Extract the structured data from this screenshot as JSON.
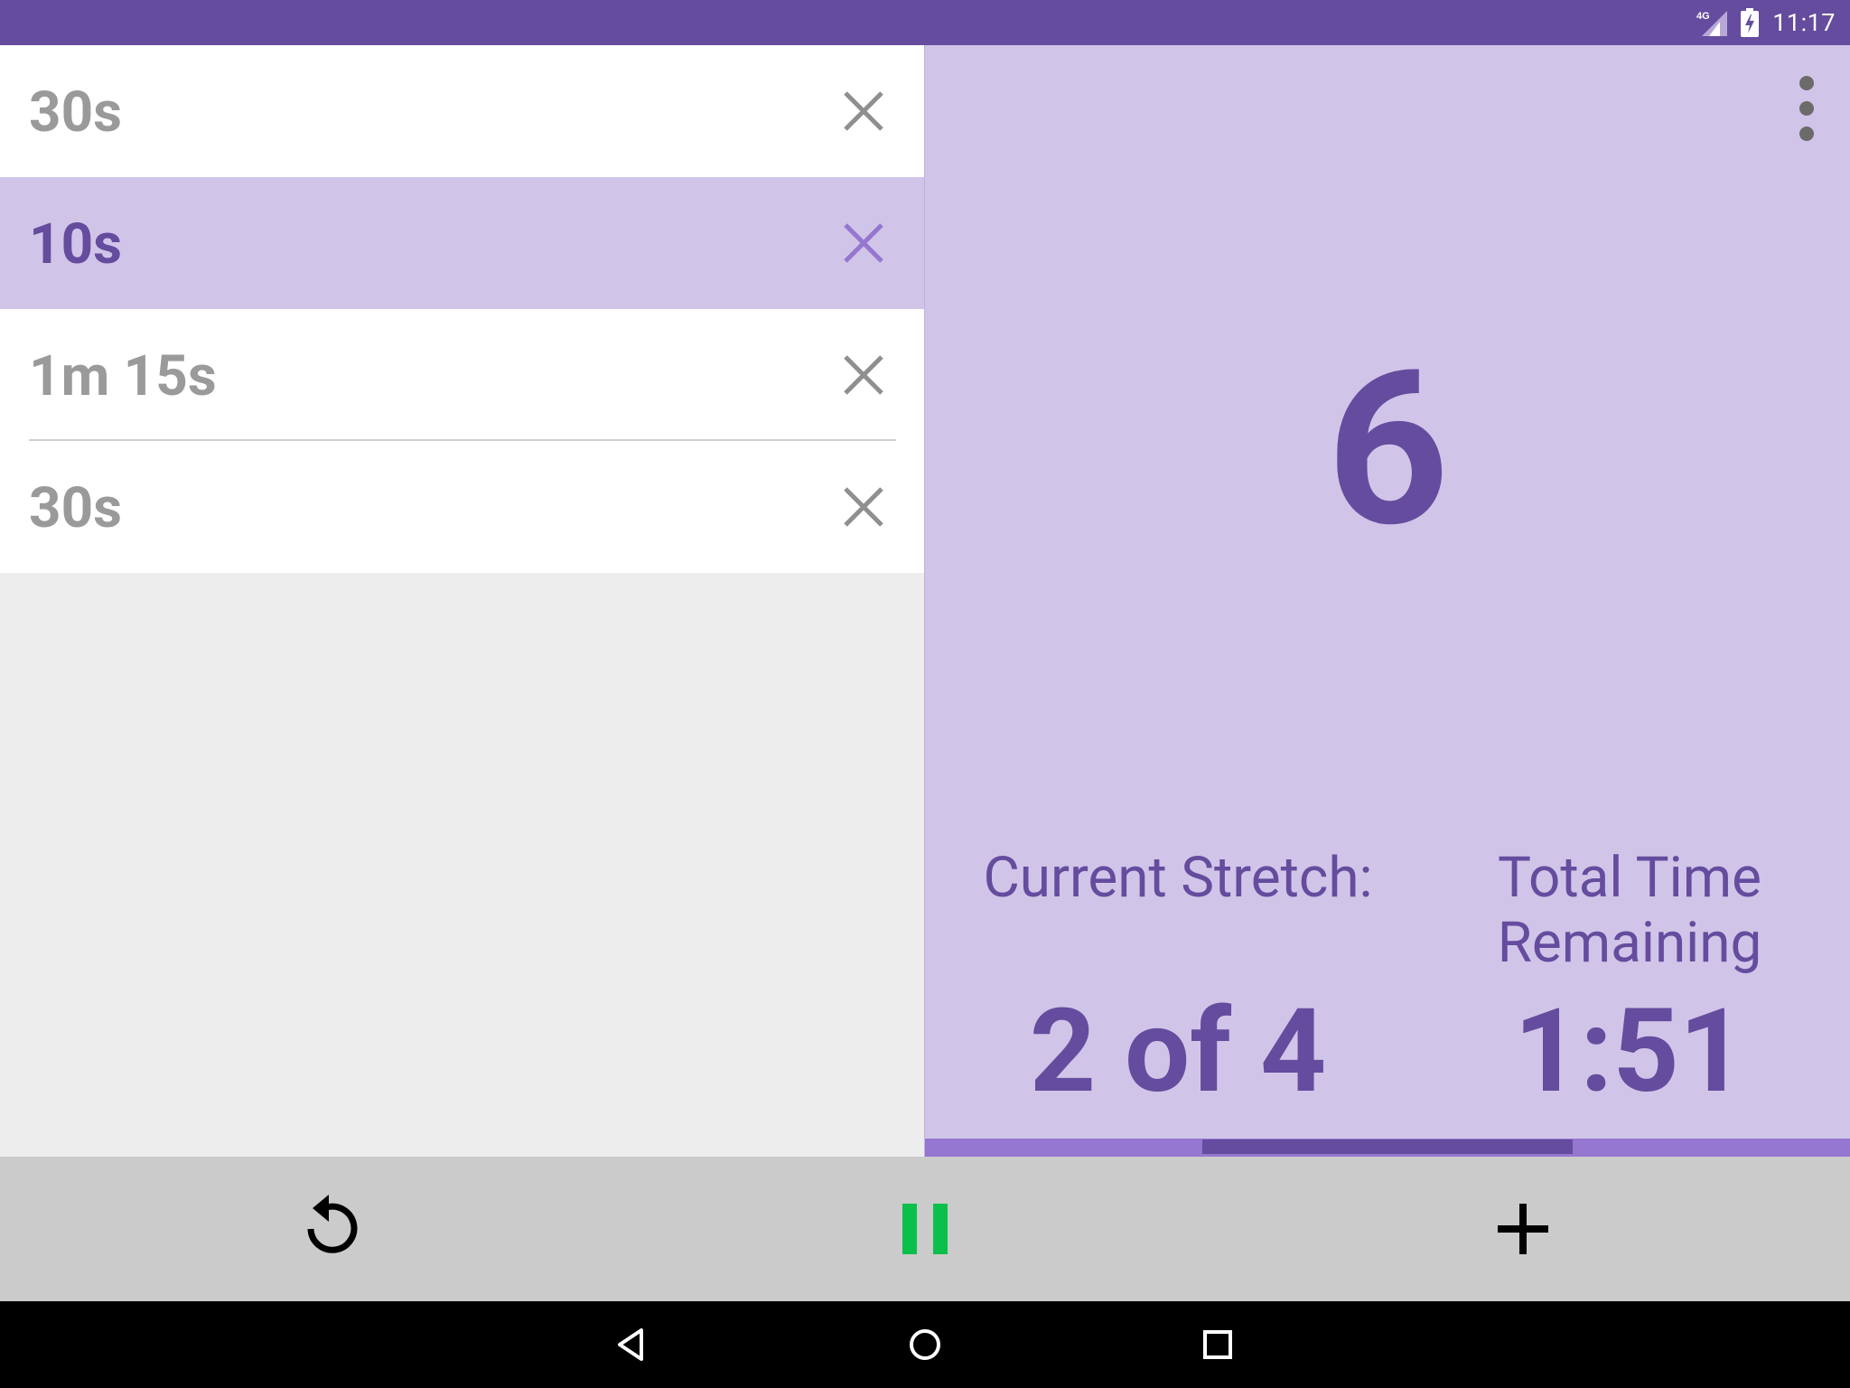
{
  "status_bar": {
    "network_label": "4G",
    "time": "11:17",
    "background_color": "#654c9e"
  },
  "stretch_list": {
    "items": [
      {
        "label": "30s",
        "selected": false
      },
      {
        "label": "10s",
        "selected": true
      },
      {
        "label": "1m 15s",
        "selected": false
      },
      {
        "label": "30s",
        "selected": false
      }
    ],
    "delete_icon": "close-icon"
  },
  "timer": {
    "countdown": "6",
    "current_stretch_label": "Current Stretch:",
    "current_stretch_value": "2 of 4",
    "total_time_label": "Total Time Remaining",
    "total_time_value": "1:51",
    "menu_icon": "more-vert-icon",
    "progress_fraction": 0.4,
    "accent_color": "#654c9e",
    "panel_color": "#d0c5e8"
  },
  "controls": {
    "restart_icon": "restart-icon",
    "pause_icon": "pause-icon",
    "add_icon": "add-icon",
    "pause_color": "#0bc04a"
  },
  "navigation": {
    "back_icon": "back-icon",
    "home_icon": "home-icon",
    "recents_icon": "recents-icon"
  }
}
